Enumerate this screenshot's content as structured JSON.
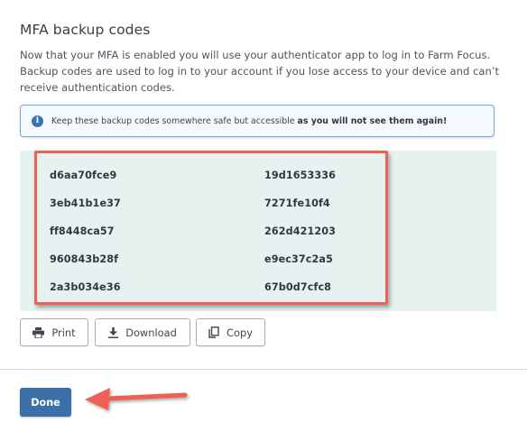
{
  "header": {
    "title": "MFA backup codes"
  },
  "description": {
    "line1": "Now that your MFA is enabled you will use your authenticator app to log in to Farm Focus.",
    "line2": "Backup codes are used to log in to your account if you lose access to your device and can’t",
    "line3": "receive authentication codes."
  },
  "notice": {
    "icon": "info-icon",
    "text": "Keep these backup codes somewhere safe but accessible ",
    "bold_text": "as you will not see them again!"
  },
  "codes": {
    "left": [
      "d6aa70fce9",
      "3eb41b1e37",
      "ff8448ca57",
      "960843b28f",
      "2a3b034e36"
    ],
    "right": [
      "19d1653336",
      "7271fe10f4",
      "262d421203",
      "e9ec37c2a5",
      "67b0d7cfc8"
    ]
  },
  "actions": {
    "print_label": "Print",
    "download_label": "Download",
    "copy_label": "Copy"
  },
  "footer": {
    "done_label": "Done"
  },
  "colors": {
    "accent": "#3a6fa8",
    "panel_bg": "#e5f2ef",
    "highlight": "#ee6053"
  }
}
